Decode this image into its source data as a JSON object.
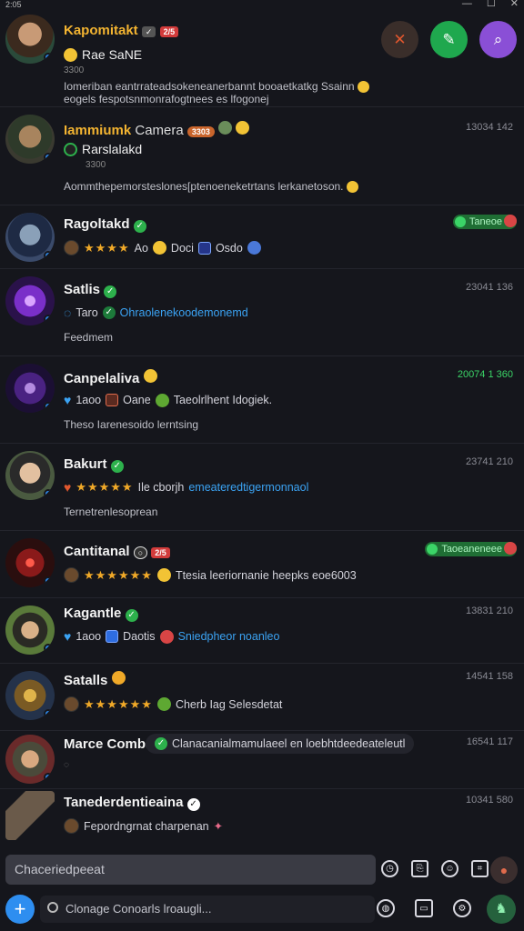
{
  "titlebar": {
    "title": "2:05",
    "minimize": "—",
    "maximize": "☐",
    "close": "✕"
  },
  "colors": {
    "background": "#15161c",
    "accent_blue": "#2e8ef0",
    "online_green": "#2db14c",
    "gold": "#f3b431"
  },
  "actions": [
    {
      "icon": "shuffle-icon",
      "glyph": "✕",
      "color": "#3a2e2a"
    },
    {
      "icon": "edit-icon",
      "glyph": "✎",
      "color": "#1fa84e"
    },
    {
      "icon": "search-icon",
      "glyph": "⌕",
      "color": "#8a4fd6"
    }
  ],
  "messages": [
    {
      "name": "Kapomitakt",
      "badge": "2/5",
      "line1": "Rae SaNE",
      "line2": "3300",
      "text1": "Iomeriban eantrrateadsokeneanerbannt booaetkatkg Ssainn",
      "text2": "eogels fespotsnmonrafogtnees es lfogonej"
    },
    {
      "name": "Iammiumk",
      "role": "Camera",
      "role_badge": "3303",
      "time": "13034 142",
      "line1": "Rarslalakd",
      "line2": "3300",
      "text1": "Aommthepemorsteslones[ptenoeneketrtans lerkanetoson."
    },
    {
      "name": "Ragoltakd",
      "pill": "Taneoe",
      "text1": "Ao",
      "text2": "Doci",
      "text3": "Osdo"
    },
    {
      "name": "Satlis",
      "time": "23041 136",
      "text1": "Taro",
      "link": "Ohraolenekoodemonemd",
      "text2": "Feedmem"
    },
    {
      "name": "Canpelaliva",
      "time": "20074 1 360",
      "text1": "1aoo",
      "text2": "Oane",
      "text3": "Taeolrlhent Idogiek.",
      "text4": "Theso Iarenesoido lerntsing"
    },
    {
      "name": "Bakurt",
      "time": "23741 210",
      "text1": "Ile cborjh",
      "link": "emeateredtigermonnaol",
      "text2": "Ternetrenlesoprean"
    },
    {
      "name": "Cantitanal",
      "badge": "2/5",
      "pill": "Taoeaneneee",
      "text1": "Ttesia leeriornanie heepks eoe6003"
    },
    {
      "name": "Kagantle",
      "time": "13831 210",
      "text1": "1aoo",
      "text2": "Daotis",
      "link": "Sniedpheor noanleo"
    },
    {
      "name": "Satalls",
      "time": "14541 158",
      "text1": "Cherb Iag Selesdetat"
    },
    {
      "name": "Marce Combas",
      "time": "16541 117",
      "text1": "Clanacanialmamulaeel en loebhtdeedeateleutl"
    },
    {
      "name": "Tanederdentieaina",
      "time": "10341 580",
      "text1": "Fepordngrnat charpenan"
    }
  ],
  "composer": {
    "placeholder": "Chaceriedpeeat"
  },
  "search": {
    "placeholder": "Clonage Conoarls lroaugli..."
  }
}
